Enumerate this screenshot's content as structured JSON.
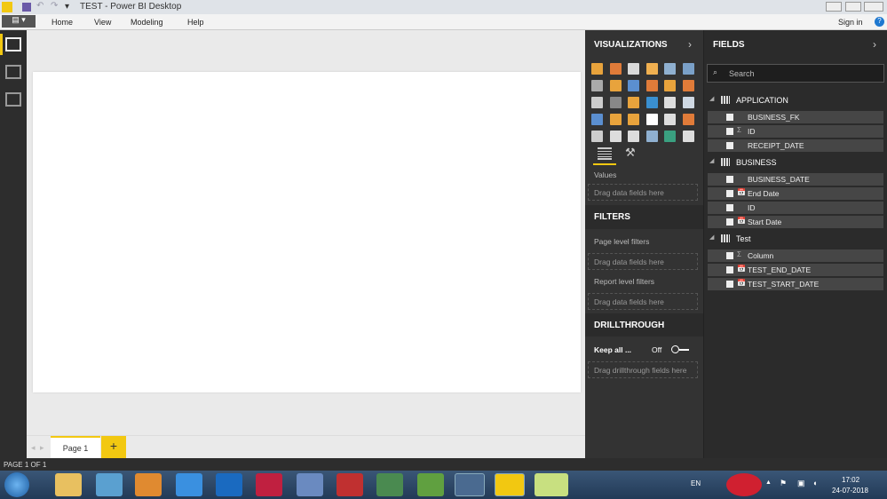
{
  "window": {
    "title": "TEST - Power BI Desktop",
    "sign_in": "Sign in"
  },
  "ribbon": {
    "tabs": [
      "Home",
      "View",
      "Modeling",
      "Help"
    ]
  },
  "visualizations": {
    "title": "VISUALIZATIONS",
    "icons": [
      "stacked-bar",
      "stacked-column",
      "clustered-bar",
      "clustered-column",
      "100-stacked-bar",
      "100-stacked-column",
      "line",
      "area",
      "stacked-area",
      "line-column",
      "line-clustered-column",
      "ribbon",
      "waterfall",
      "scatter",
      "pie",
      "donut",
      "treemap",
      "map",
      "filled-map",
      "funnel",
      "gauge",
      "card",
      "multi-row-card",
      "kpi",
      "slicer",
      "table",
      "matrix",
      "r-script",
      "arcgis-map",
      "more"
    ],
    "icon_colors": [
      "#e8a33c",
      "#e07b39",
      "#d9d9d9",
      "#f0b050",
      "#8fb0d0",
      "#7aa0c8",
      "#aaaaaa",
      "#e8a33c",
      "#5b8fd0",
      "#e07b39",
      "#e8a33c",
      "#e07b39",
      "#cccccc",
      "#888888",
      "#e8a33c",
      "#3a8fd0",
      "#dddddd",
      "#cfd8e3",
      "#5b8fd0",
      "#e8a33c",
      "#e8a33c",
      "#ffffff",
      "#dddddd",
      "#e07b39",
      "#cccccc",
      "#dddddd",
      "#dddddd",
      "#8fb0d0",
      "#3aa080",
      "#dddddd"
    ],
    "values_label": "Values",
    "values_drop": "Drag data fields here"
  },
  "filters": {
    "title": "FILTERS",
    "page_label": "Page level filters",
    "page_drop": "Drag data fields here",
    "report_label": "Report level filters",
    "report_drop": "Drag data fields here"
  },
  "drillthrough": {
    "title": "DRILLTHROUGH",
    "keep_all": "Keep all ...",
    "toggle_state": "Off",
    "drop": "Drag drillthrough fields here"
  },
  "fields": {
    "title": "FIELDS",
    "search_placeholder": "Search",
    "tables": [
      {
        "name": "APPLICATION",
        "fields": [
          {
            "name": "BUSINESS_FK",
            "type": ""
          },
          {
            "name": "ID",
            "type": "Σ"
          },
          {
            "name": "RECEIPT_DATE",
            "type": ""
          }
        ]
      },
      {
        "name": "BUSINESS",
        "fields": [
          {
            "name": "BUSINESS_DATE",
            "type": ""
          },
          {
            "name": "End Date",
            "type": "📅"
          },
          {
            "name": "ID",
            "type": ""
          },
          {
            "name": "Start Date",
            "type": "📅"
          }
        ]
      },
      {
        "name": "Test",
        "fields": [
          {
            "name": "Column",
            "type": "Σ"
          },
          {
            "name": "TEST_END_DATE",
            "type": "📅"
          },
          {
            "name": "TEST_START_DATE",
            "type": "📅"
          }
        ]
      }
    ]
  },
  "pages": {
    "tabs": [
      "Page 1"
    ],
    "add": "+"
  },
  "status": {
    "text": "PAGE 1 OF 1"
  },
  "taskbar": {
    "lang": "EN",
    "time": "17:02",
    "date": "24-07-2018"
  }
}
